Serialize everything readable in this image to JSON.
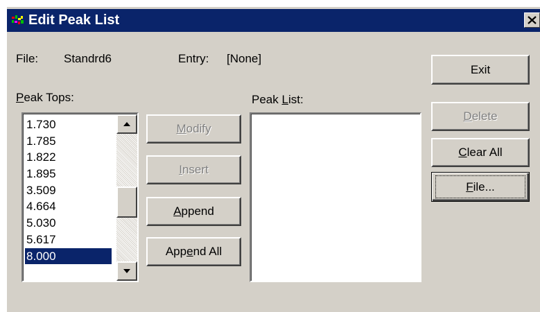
{
  "window": {
    "title": "Edit Peak List",
    "close_glyph": "✕"
  },
  "header": {
    "file_label": "File:",
    "file_value": "Standrd6",
    "entry_label": "Entry:",
    "entry_value": "[None]"
  },
  "peak_tops": {
    "label_prefix": "",
    "label_accel": "P",
    "label_suffix": "eak Tops:",
    "items": [
      "1.730",
      "1.785",
      "1.822",
      "1.895",
      "3.509",
      "4.664",
      "5.030",
      "5.617",
      "8.000"
    ],
    "selected_index": 8
  },
  "peak_list": {
    "label_prefix": "Peak ",
    "label_accel": "L",
    "label_suffix": "ist:",
    "items": []
  },
  "middle_buttons": {
    "modify": {
      "prefix": "",
      "accel": "M",
      "suffix": "odify",
      "enabled": false
    },
    "insert": {
      "prefix": "",
      "accel": "I",
      "suffix": "nsert",
      "enabled": false
    },
    "append": {
      "prefix": "",
      "accel": "A",
      "suffix": "ppend",
      "enabled": true
    },
    "append_all": {
      "prefix": "App",
      "accel": "e",
      "suffix": "nd All",
      "enabled": true
    }
  },
  "right_buttons": {
    "exit": {
      "prefix": "Exit",
      "accel": "",
      "suffix": "",
      "enabled": true
    },
    "delete": {
      "prefix": "",
      "accel": "D",
      "suffix": "elete",
      "enabled": false
    },
    "clear_all": {
      "prefix": "",
      "accel": "C",
      "suffix": "lear All",
      "enabled": true
    },
    "file": {
      "prefix": "",
      "accel": "F",
      "suffix": "ile...",
      "enabled": true,
      "focused": true
    }
  },
  "colors": {
    "titlebar": "#0a246a",
    "dialog_bg": "#d4d0c8",
    "selection": "#0a246a"
  },
  "icons": {
    "app": "peak-chart-icon",
    "close": "close-icon",
    "scroll_up": "scroll-up-arrow-icon",
    "scroll_down": "scroll-down-arrow-icon"
  }
}
